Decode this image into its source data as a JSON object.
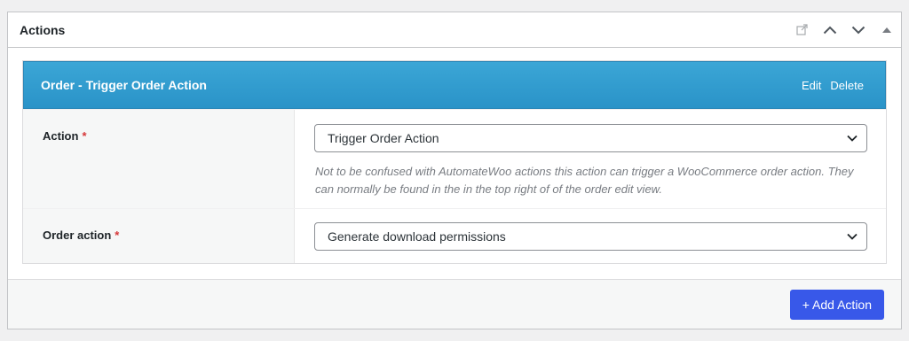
{
  "panel": {
    "title": "Actions",
    "controls": {
      "external_icon": "external-link-icon",
      "up_icon": "chevron-up-icon",
      "down_icon": "chevron-down-icon",
      "toggle_icon": "triangle-up-icon"
    }
  },
  "action": {
    "title": "Order - Trigger Order Action",
    "edit_label": "Edit",
    "delete_label": "Delete",
    "header_color": "#2f9bd0",
    "fields": [
      {
        "label": "Action",
        "required_mark": "*",
        "value": "Trigger Order Action",
        "description": "Not to be confused with AutomateWoo actions this action can trigger a WooCommerce order action. They can normally be found in the in the top right of of the order edit view."
      },
      {
        "label": "Order action",
        "required_mark": "*",
        "value": "Generate download permissions"
      }
    ]
  },
  "footer": {
    "add_button_label": "+ Add Action",
    "button_color": "#3858e9"
  }
}
